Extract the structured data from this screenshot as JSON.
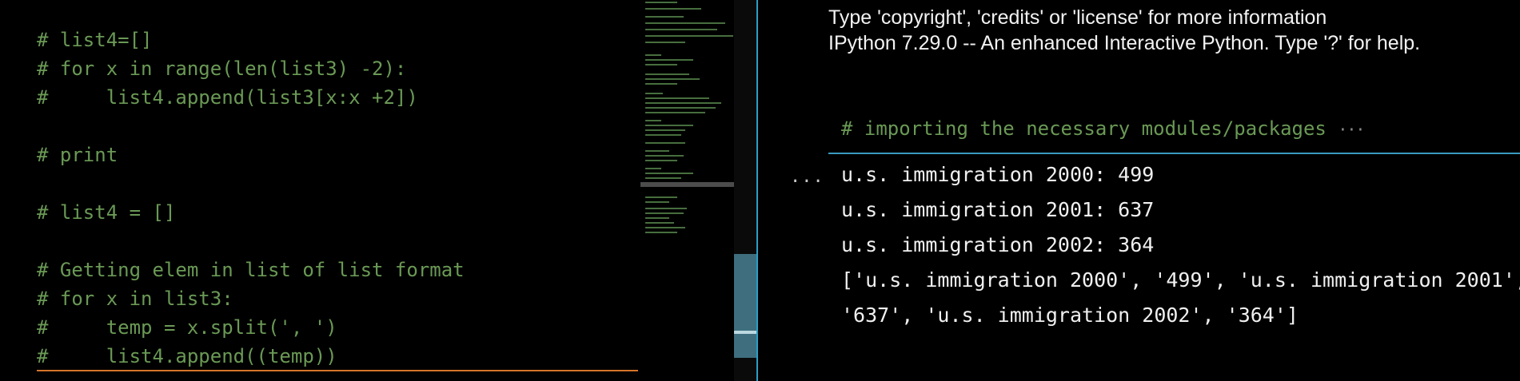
{
  "editor": {
    "lines": [
      "# list4=[]",
      "# for x in range(len(list3) -2):",
      "#     list4.append(list3[x:x +2])",
      "",
      "# print",
      "",
      "# list4 = []",
      "",
      "# Getting elem in list of list format",
      "# for x in list3:",
      "#     temp = x.split(', ')",
      "#     list4.append((temp))"
    ]
  },
  "terminal": {
    "banner": [
      "Type 'copyright', 'credits' or 'license' for more information",
      "IPython 7.29.0 -- An enhanced Interactive Python. Type '?' for help."
    ],
    "cell_preview": "# importing the necessary modules/packages",
    "cell_collapsed_indicator": "···",
    "output_prompt": "...",
    "output_lines": [
      "u.s. immigration 2000: 499",
      "u.s. immigration 2001: 637",
      "u.s. immigration 2002: 364",
      "['u.s. immigration 2000', '499', 'u.s. immigration 2001',",
      "'637', 'u.s. immigration 2002', '364']"
    ]
  },
  "colors": {
    "comment": "#6a9955",
    "accent": "#2aa0c8",
    "active_line": "#d4742b"
  }
}
